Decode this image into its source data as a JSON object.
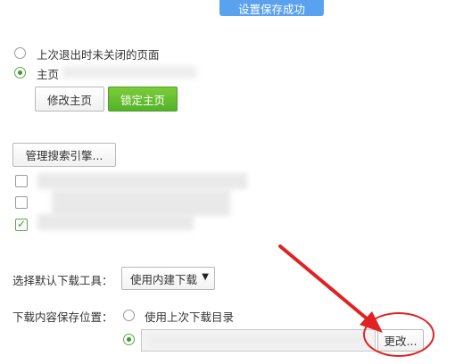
{
  "toast": {
    "text": "设置保存成功"
  },
  "startup": {
    "option_last_pages": "上次退出时未关闭的页面",
    "option_homepage": "主页",
    "modify_homepage": "修改主页",
    "lock_homepage": "锁定主页"
  },
  "search": {
    "manage_engines": "管理搜索引擎..."
  },
  "download": {
    "tool_label": "选择默认下载工具：",
    "tool_selected": "使用内建下载",
    "location_label": "下载内容保存位置：",
    "option_last_dir": "使用上次下载目录",
    "change_button": "更改..."
  },
  "colors": {
    "toast_bg": "#5aa2ef",
    "primary_button": "#55b22b",
    "radio_checked": "#3a9b2f",
    "highlight_red": "#e02222"
  },
  "icons": {
    "selected_radio": "radio-dot",
    "check": "check-mark",
    "dropdown": "triangle-down",
    "annotation": "red-arrow"
  }
}
